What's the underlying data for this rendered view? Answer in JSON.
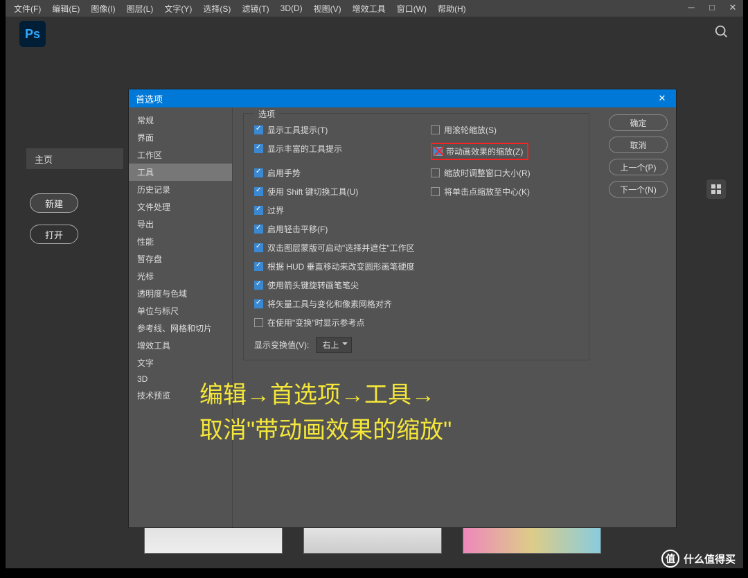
{
  "menubar": [
    "文件(F)",
    "编辑(E)",
    "图像(I)",
    "图层(L)",
    "文字(Y)",
    "选择(S)",
    "滤镜(T)",
    "3D(D)",
    "视图(V)",
    "增效工具",
    "窗口(W)",
    "帮助(H)"
  ],
  "logo": "Ps",
  "home": {
    "label": "主页",
    "new": "新建",
    "open": "打开"
  },
  "dialog": {
    "title": "首选项",
    "sidebar": [
      "常规",
      "界面",
      "工作区",
      "工具",
      "历史记录",
      "文件处理",
      "导出",
      "性能",
      "暂存盘",
      "光标",
      "透明度与色域",
      "单位与标尺",
      "参考线、网格和切片",
      "增效工具",
      "文字",
      "3D",
      "技术预览"
    ],
    "selected_index": 3,
    "group_label": "选项",
    "left_opts": [
      {
        "label": "显示工具提示(T)",
        "on": true
      },
      {
        "label": "显示丰富的工具提示",
        "on": true
      },
      {
        "label": "启用手势",
        "on": true
      },
      {
        "label": "使用 Shift 键切换工具(U)",
        "on": true
      },
      {
        "label": "过界",
        "on": true
      },
      {
        "label": "启用轻击平移(F)",
        "on": true
      },
      {
        "label": "双击图层蒙版可启动\"选择并遮住\"工作区",
        "on": true
      },
      {
        "label": "根据 HUD 垂直移动来改变圆形画笔硬度",
        "on": true
      },
      {
        "label": "使用箭头键旋转画笔笔尖",
        "on": true
      },
      {
        "label": "将矢量工具与变化和像素网格对齐",
        "on": true
      },
      {
        "label": "在使用\"变换\"时显示参考点",
        "on": false
      }
    ],
    "right_opts": [
      {
        "label": "用滚轮缩放(S)",
        "on": false
      },
      {
        "label": "带动画效果的缩放(Z)",
        "on": true,
        "highlight": true
      },
      {
        "label": "缩放时调整窗口大小(R)",
        "on": false
      },
      {
        "label": "将单击点缩放至中心(K)",
        "on": false
      }
    ],
    "transform_label": "显示变换值(V):",
    "transform_value": "右上",
    "buttons": [
      "确定",
      "取消",
      "上一个(P)",
      "下一个(N)"
    ]
  },
  "annotation": {
    "line1": "编辑→首选项→工具→",
    "line2": "取消\"带动画效果的缩放\""
  },
  "watermark": {
    "icon": "值",
    "text": "什么值得买"
  }
}
